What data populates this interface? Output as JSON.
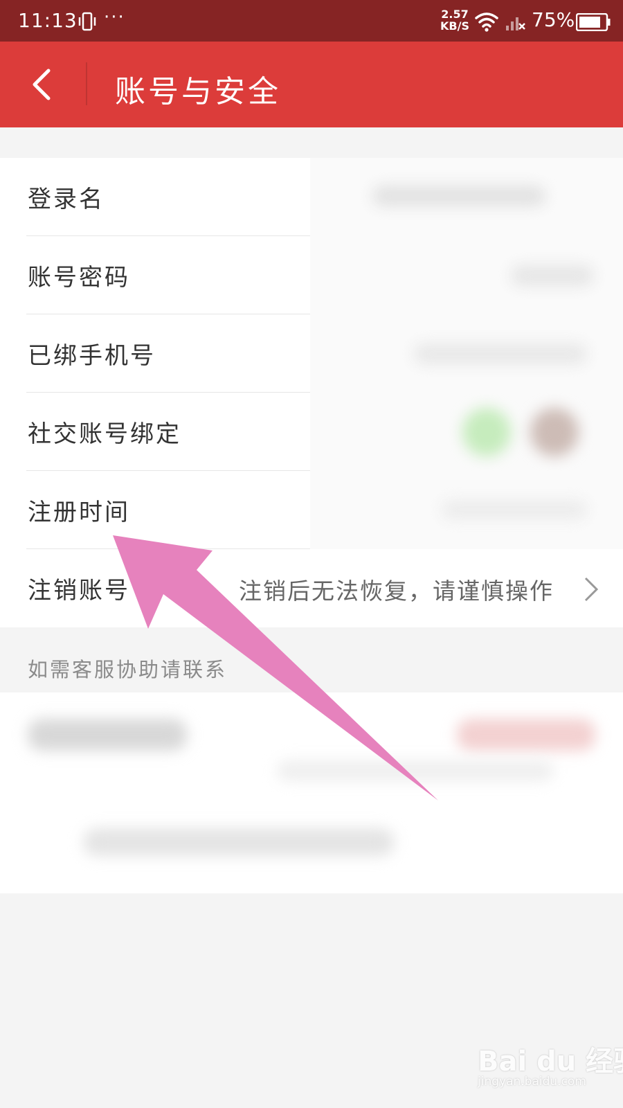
{
  "status_bar": {
    "time": "11:13",
    "more": "···",
    "net_speed_value": "2.57",
    "net_speed_unit": "KB/S",
    "battery_percent": "75%"
  },
  "header": {
    "title": "账号与安全",
    "back_icon": "chevron-left-icon",
    "background": "#dc3c3a"
  },
  "rows": [
    {
      "label": "登录名"
    },
    {
      "label": "账号密码"
    },
    {
      "label": "已绑手机号"
    },
    {
      "label": "社交账号绑定"
    },
    {
      "label": "注册时间"
    },
    {
      "label": "注销账号",
      "hint": "注销后无法恢复，请谨慎操作"
    }
  ],
  "help": {
    "text": "如需客服协助请联系"
  },
  "annotation": {
    "arrow_color": "#e682bd"
  },
  "watermark": {
    "brand": "Bai du 经验",
    "url": "jingyan.baidu.com"
  }
}
